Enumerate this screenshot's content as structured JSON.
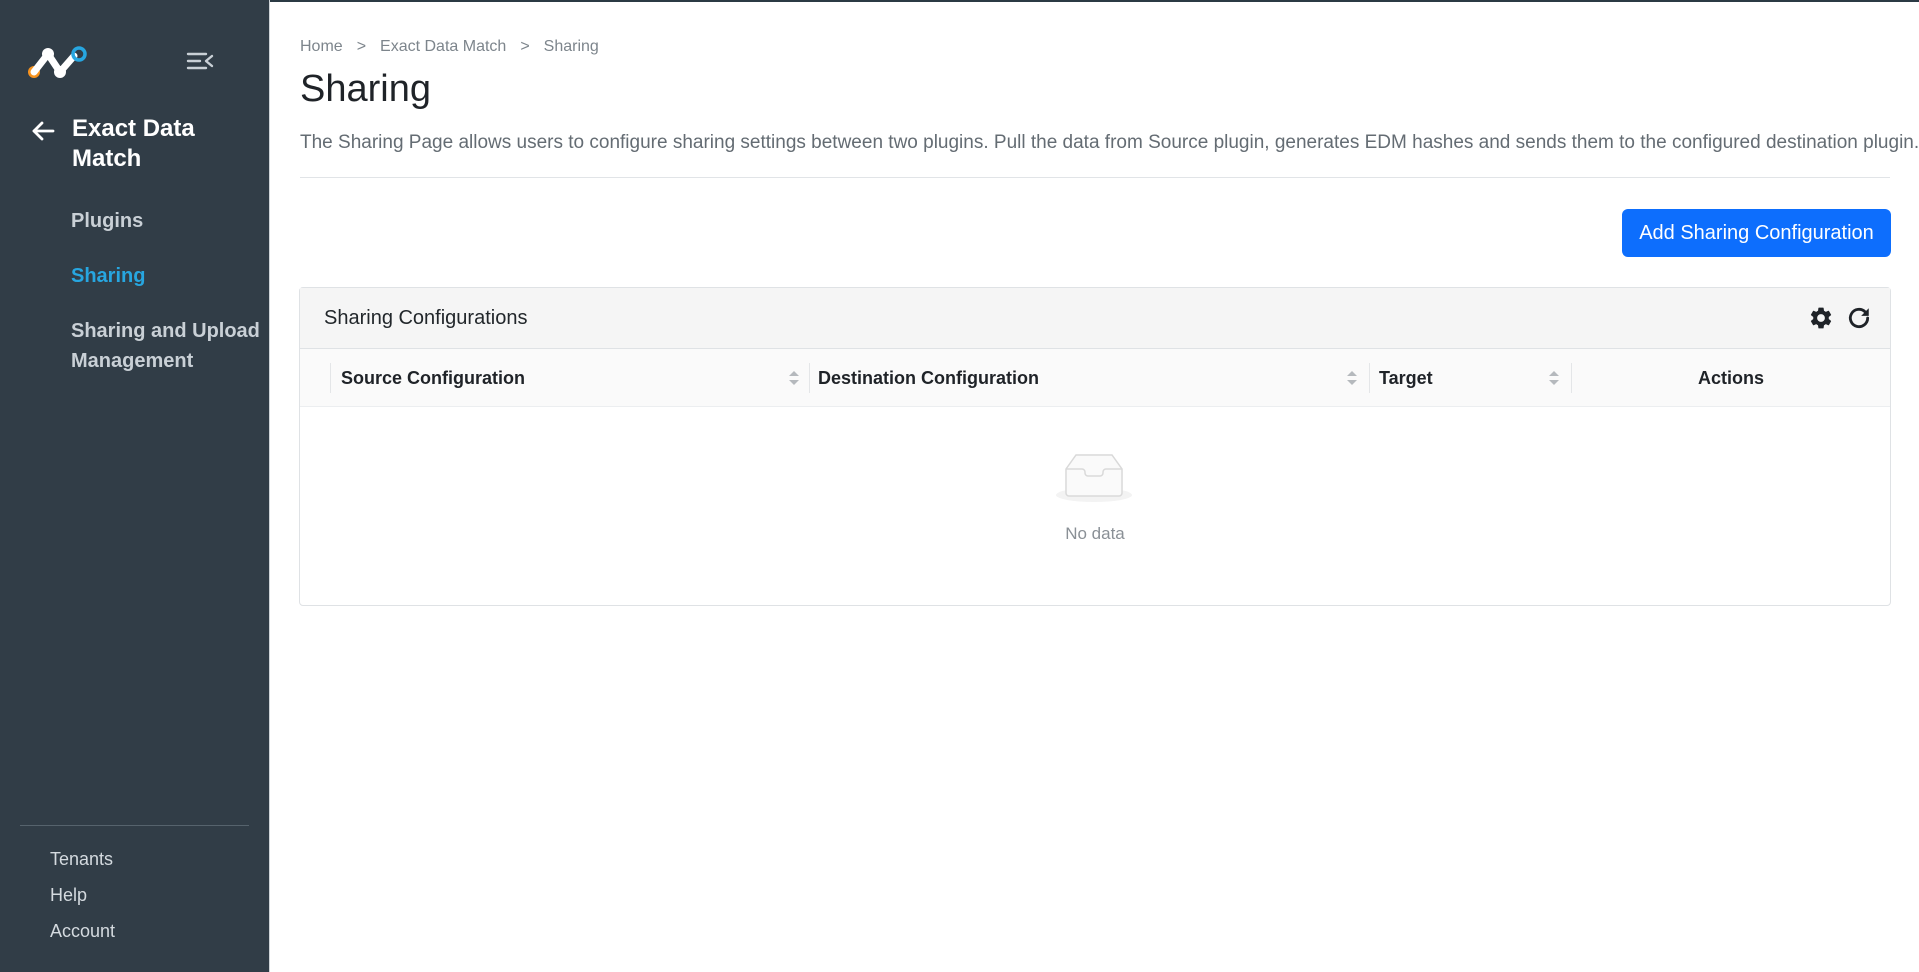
{
  "sidebar": {
    "section_title": "Exact Data Match",
    "nav_items": [
      {
        "label": "Plugins",
        "active": false
      },
      {
        "label": "Sharing",
        "active": true
      },
      {
        "label": "Sharing and Upload Management",
        "active": false
      }
    ],
    "footer_items": [
      {
        "label": "Tenants"
      },
      {
        "label": "Help"
      },
      {
        "label": "Account"
      }
    ]
  },
  "breadcrumb": {
    "items": [
      "Home",
      "Exact Data Match",
      "Sharing"
    ],
    "separator": ">"
  },
  "page": {
    "title": "Sharing",
    "description": "The Sharing Page allows users to configure sharing settings between two plugins. Pull the data from Source plugin, generates EDM hashes and sends them to the configured destination plugin."
  },
  "toolbar": {
    "add_label": "Add Sharing Configuration"
  },
  "table": {
    "title": "Sharing Configurations",
    "columns": [
      {
        "label": "Source Configuration",
        "sortable": true
      },
      {
        "label": "Destination Configuration",
        "sortable": true
      },
      {
        "label": "Target",
        "sortable": true
      },
      {
        "label": "Actions",
        "sortable": false
      }
    ],
    "rows": [],
    "empty_text": "No data"
  },
  "colors": {
    "sidebar_bg": "#313d47",
    "accent": "#27a6e0",
    "primary_button": "#0d6efd",
    "logo_orange": "#f7931e",
    "logo_blue": "#27a6e0"
  },
  "icons": [
    "logo-icon",
    "menu-collapse-icon",
    "arrow-left-icon",
    "gear-icon",
    "refresh-icon",
    "sort-icon",
    "empty-inbox-icon"
  ]
}
